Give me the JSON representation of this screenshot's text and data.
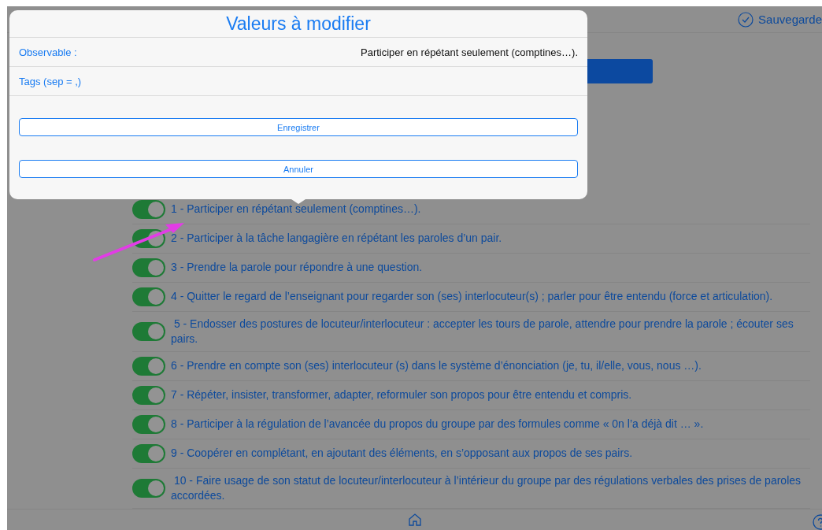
{
  "header": {
    "save_label": "Sauvegarde"
  },
  "observables": [
    {
      "label": "1 - Participer en répétant seulement (comptines…).",
      "on": true
    },
    {
      "label": "2 - Participer à la tâche langagière en répétant les paroles d’un pair.",
      "on": true
    },
    {
      "label": "3 - Prendre la parole pour répondre à une question.",
      "on": true
    },
    {
      "label": "4 - Quitter le regard de l’enseignant pour regarder son (ses) interlocuteur(s) ; parler pour être entendu (force et articulation).",
      "on": true
    },
    {
      "label": " 5 - Endosser des postures de locuteur/interlocuteur : accepter les tours de parole, attendre pour prendre la parole ; écouter ses pairs.",
      "on": true
    },
    {
      "label": "6 - Prendre en compte son (ses) interlocuteur (s) dans le système d’énonciation (je, tu, il/elle, vous, nous …).",
      "on": true
    },
    {
      "label": "7 - Répéter, insister, transformer, adapter, reformuler son propos pour être entendu et compris.",
      "on": true
    },
    {
      "label": "8 - Participer à la régulation de l’avancée du propos du groupe par des formules comme « 0n l’a déjà dit … ».",
      "on": true
    },
    {
      "label": "9 - Coopérer en complétant, en ajoutant des éléments, en s’opposant aux propos de ses pairs.",
      "on": true
    },
    {
      "label": " 10 - Faire usage de son statut de locuteur/interlocuteur à l’intérieur du groupe par des régulations verbales des prises de paroles accordées.",
      "on": true
    }
  ],
  "modal": {
    "title": "Valeurs à modifier",
    "fields": [
      {
        "label": "Observable :",
        "value": "Participer en répétant seulement (comptines…)."
      },
      {
        "label": "Tags (sep = ,)"
      }
    ],
    "buttons": [
      "Enregistrer",
      "Annuler"
    ]
  }
}
